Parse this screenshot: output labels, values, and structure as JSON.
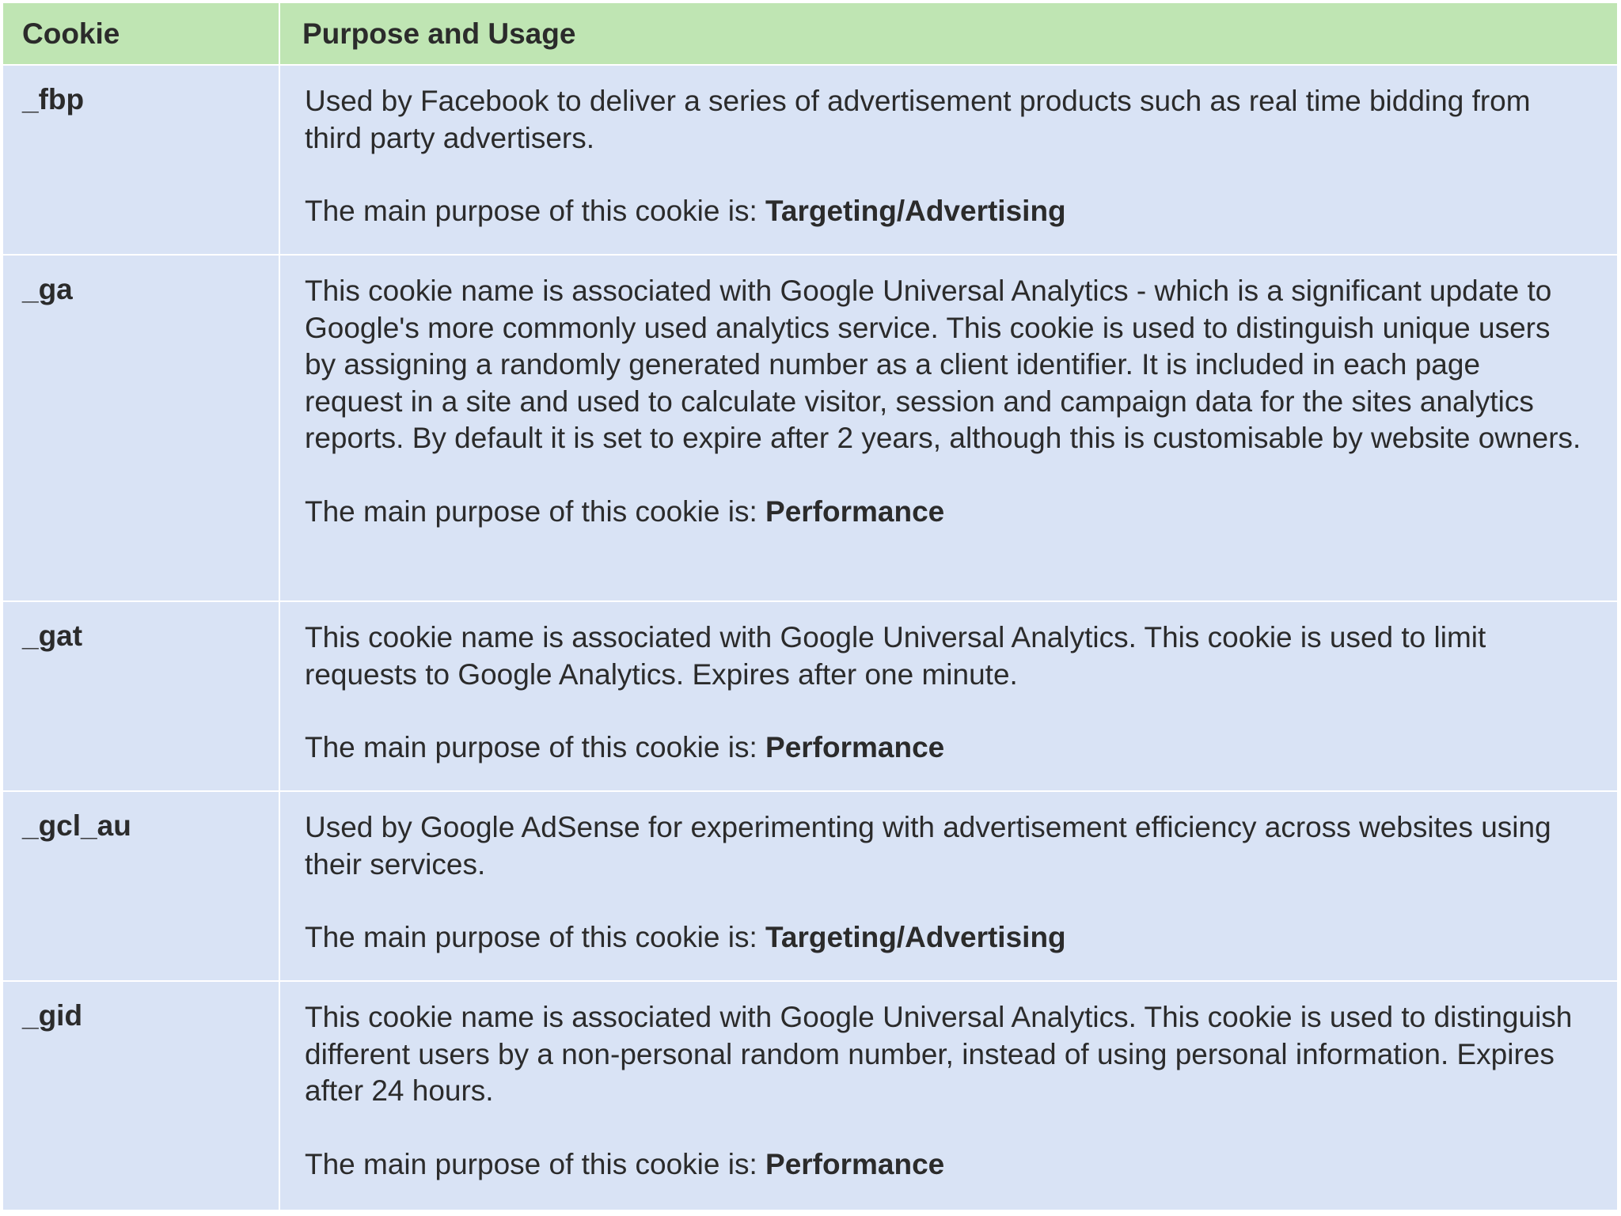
{
  "table": {
    "header": {
      "cookie": "Cookie",
      "purpose": "Purpose and Usage"
    },
    "purpose_prefix": "The main purpose of this cookie is: ",
    "rows": [
      {
        "name": "_fbp",
        "description": "Used by Facebook to deliver a series of advertisement products such as real time bidding from third party advertisers.",
        "purpose": "Targeting/Advertising"
      },
      {
        "name": "_ga",
        "description": "This cookie name is associated with Google Universal Analytics - which is a significant update to Google's more commonly used analytics service. This cookie is used to distinguish unique users by assigning a randomly generated number as a client identifier. It is included in each page request in a site and used to calculate visitor, session and campaign data for the sites analytics reports. By default it is set to expire after 2 years, although this is customisable by website owners.",
        "purpose": "Performance"
      },
      {
        "name": "_gat",
        "description": "This cookie name is associated with Google Universal Analytics. This cookie is used to limit requests to Google Analytics. Expires after one minute.",
        "purpose": "Performance"
      },
      {
        "name": "_gcl_au",
        "description": "Used by Google AdSense for experimenting with advertisement efficiency across websites using their services.",
        "purpose": "Targeting/Advertising"
      },
      {
        "name": "_gid",
        "description": "This cookie name is associated with Google Universal Analytics. This cookie is used to distinguish different users by a non-personal random number, instead of using personal information. Expires after 24 hours.",
        "purpose": "Performance"
      }
    ]
  },
  "colors": {
    "header_bg": "#bfe5b3",
    "row_bg": "#d9e3f5",
    "border": "#ffffff",
    "text": "#2b2b2b"
  }
}
